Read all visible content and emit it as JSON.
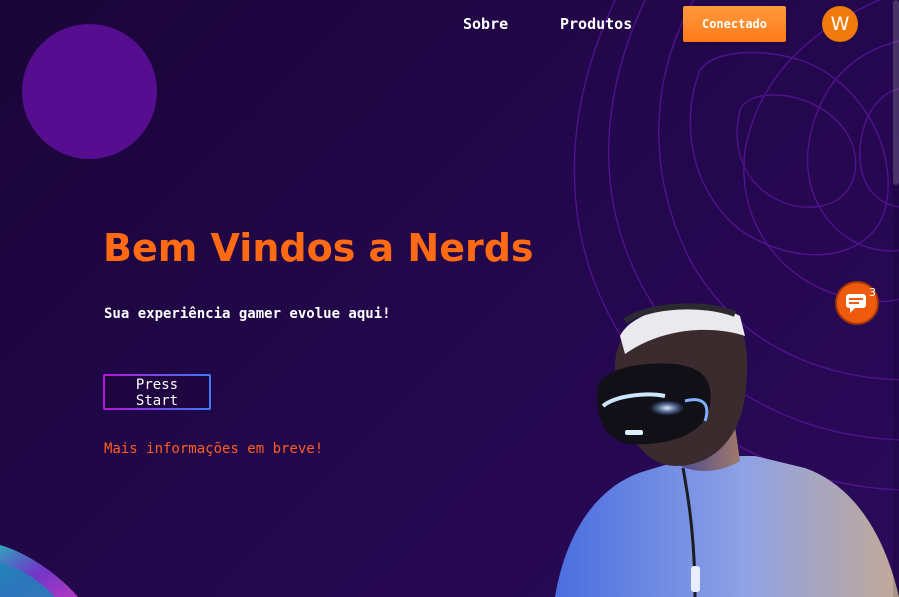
{
  "nav": {
    "links": [
      {
        "label": "Sobre"
      },
      {
        "label": "Produtos"
      }
    ],
    "connected_button": "Conectado",
    "avatar_initial": "W"
  },
  "hero": {
    "title": "Bem Vindos a Nerds",
    "subtitle": "Sua experiência gamer evolue aqui!",
    "cta_button": "Press Start",
    "info": "Mais informações em breve!"
  },
  "chat": {
    "icon": "chat-bubble-icon",
    "badge_count": "3"
  },
  "colors": {
    "accent_orange": "#ff6a13",
    "background": "#1e0640",
    "deco_circle": "#560d8f",
    "contour_lines": "#5a139a"
  }
}
